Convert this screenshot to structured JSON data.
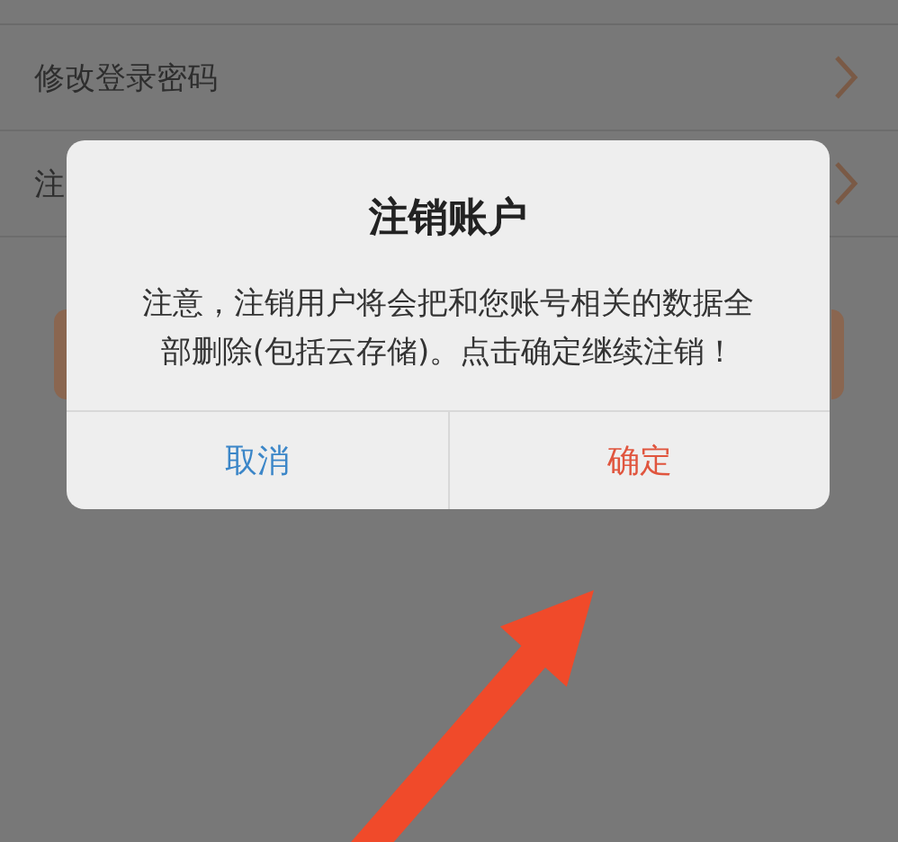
{
  "settings_rows": [
    {
      "label": "修改登录密码"
    },
    {
      "label": "注"
    }
  ],
  "dialog": {
    "title": "注销账户",
    "message": "注意，注销用户将会把和您账号相关的数据全部删除(包括云存储)。点击确定继续注销！",
    "buttons": [
      {
        "label": "取消",
        "kind": "cancel"
      },
      {
        "label": "确定",
        "kind": "confirm"
      }
    ]
  }
}
